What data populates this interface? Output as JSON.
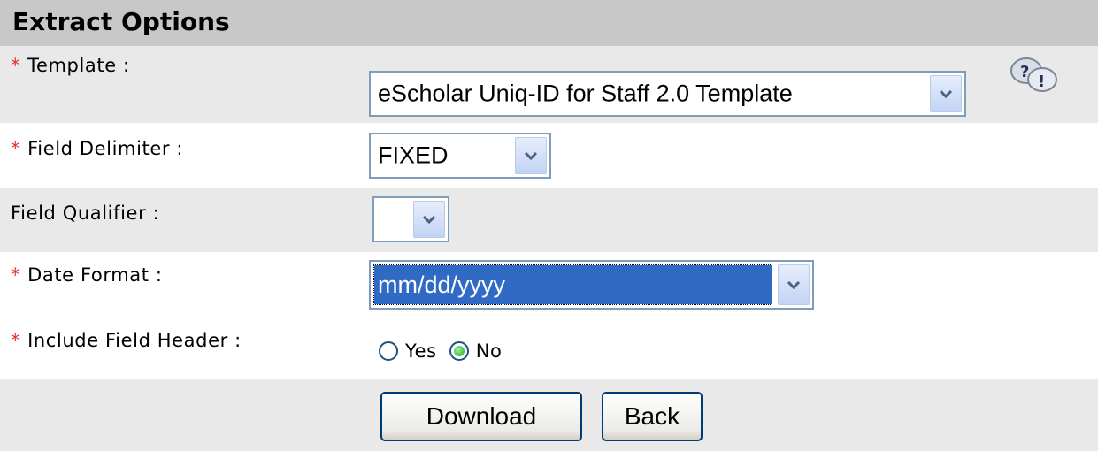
{
  "header": {
    "title": "Extract Options"
  },
  "required_marker": "*",
  "fields": {
    "template": {
      "label": "Template :",
      "value": "eScholar Uniq-ID for Staff 2.0 Template"
    },
    "field_delimiter": {
      "label": "Field Delimiter :",
      "value": "FIXED"
    },
    "field_qualifier": {
      "label": "Field Qualifier :",
      "value": ""
    },
    "date_format": {
      "label": "Date Format :",
      "value": "mm/dd/yyyy"
    },
    "include_field_header": {
      "label": "Include Field Header :",
      "options": [
        {
          "label": "Yes",
          "checked": false
        },
        {
          "label": "No",
          "checked": true
        }
      ]
    }
  },
  "buttons": {
    "download": "Download",
    "back": "Back"
  },
  "icons": {
    "help": "help-icon",
    "dropdown": "chevron-down-icon"
  },
  "colors": {
    "header_bg": "#c8c8c8",
    "row_alt_bg": "#e9e9e9",
    "required": "#e0302a",
    "selection": "#316ac5"
  }
}
